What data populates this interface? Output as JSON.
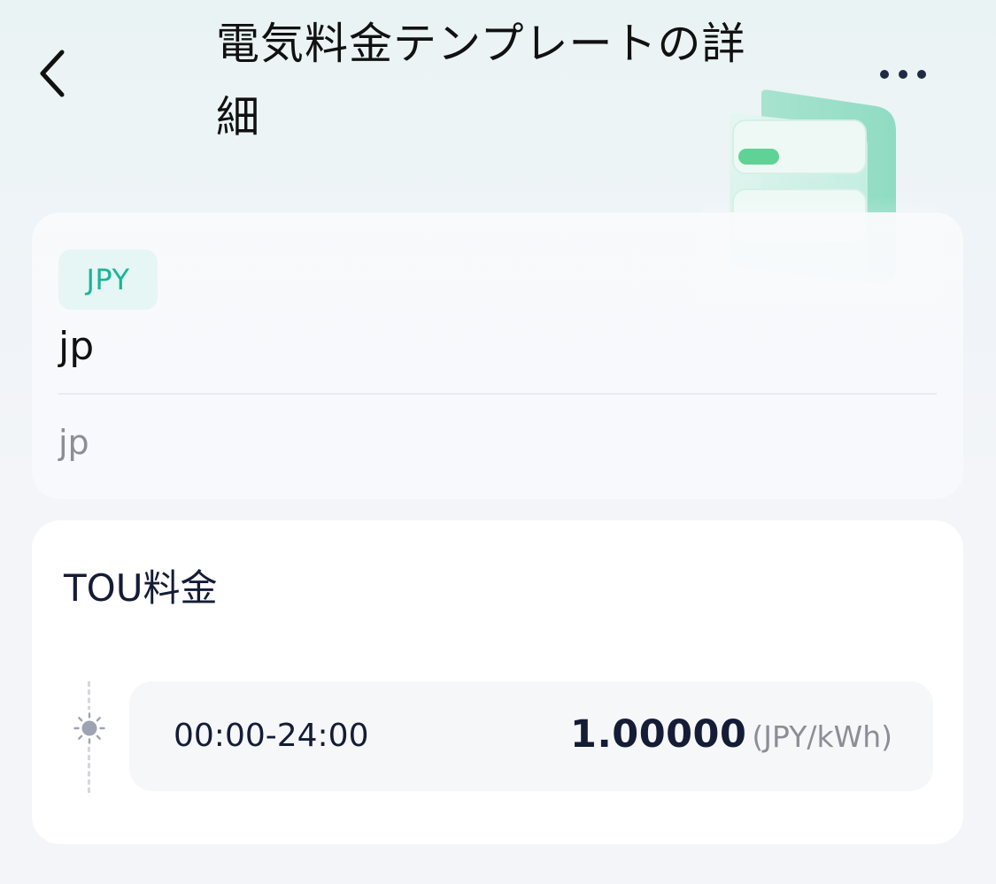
{
  "header": {
    "title": "電気料金テンプレートの詳細",
    "back_icon": "chevron-left-icon",
    "more_icon": "more-horizontal-icon"
  },
  "template": {
    "currency": "JPY",
    "name": "jp",
    "description": "jp"
  },
  "tou": {
    "title": "TOU料金",
    "periods": [
      {
        "icon": "sun-icon",
        "time": "00:00-24:00",
        "price": "1.00000",
        "unit": "(JPY/kWh)"
      }
    ]
  },
  "colors": {
    "accent": "#1ab599",
    "badge_bg": "#e6f6f4",
    "text_primary": "#141c36",
    "text_secondary": "#8c8e96",
    "illustration_green": "#5fd396"
  }
}
